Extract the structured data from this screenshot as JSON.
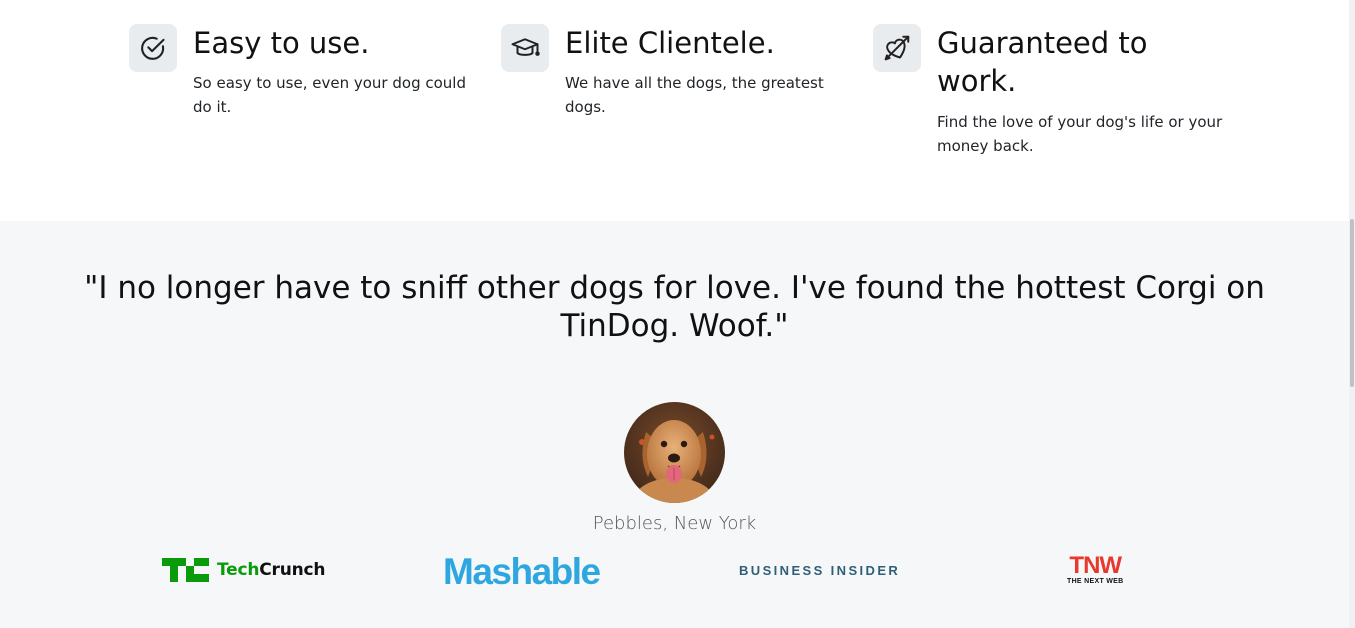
{
  "features": [
    {
      "icon": "check-circle-icon",
      "title": "Easy to use.",
      "text": "So easy to use, even your dog could do it."
    },
    {
      "icon": "graduation-cap-icon",
      "title": "Elite Clientele.",
      "text": "We have all the dogs, the greatest dogs."
    },
    {
      "icon": "heart-arrow-icon",
      "title": "Guaranteed to work.",
      "text": "Find the love of your dog's life or your money back."
    }
  ],
  "testimonial": {
    "quote": "\"I no longer have to sniff other dogs for love. I've found the hottest Corgi on TinDog. Woof.\"",
    "avatar": "dog-profile-image",
    "caption": "Pebbles, New York"
  },
  "press": {
    "techcrunch": {
      "mark": "TC",
      "tech": "Tech",
      "crunch": "Crunch"
    },
    "mashable": "Mashable",
    "business_insider": "BUSINESS INSIDER",
    "tnw": {
      "big": "TNW",
      "small": "THE NEXT WEB"
    }
  },
  "colors": {
    "section_bg": "#f6f7f9",
    "icon_bg": "#e9ecef",
    "techcrunch_green": "#0a9b0a",
    "mashable_blue": "#2ea7e0",
    "business_insider": "#2f5f78",
    "tnw_red": "#e8392c"
  }
}
